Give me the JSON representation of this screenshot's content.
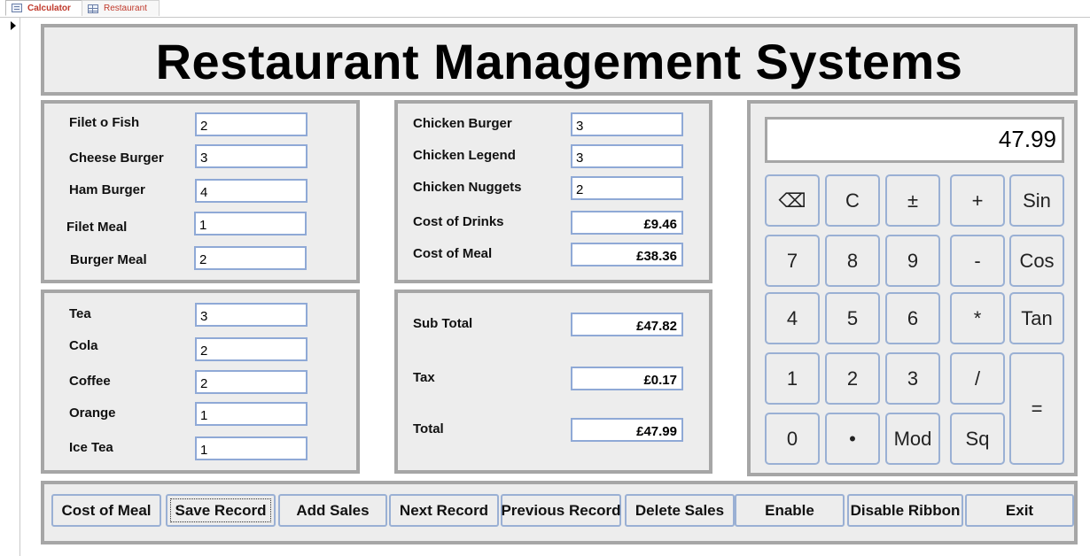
{
  "tabs": [
    {
      "label": "Calculator",
      "icon": "form-icon",
      "active": true
    },
    {
      "label": "Restaurant",
      "icon": "table-icon",
      "active": false
    }
  ],
  "title": "Restaurant Management Systems",
  "food": {
    "filet_o_fish": {
      "label": "Filet o Fish",
      "value": "2"
    },
    "cheese_burger": {
      "label": "Cheese Burger",
      "value": "3"
    },
    "ham_burger": {
      "label": "Ham Burger",
      "value": "4"
    },
    "filet_meal": {
      "label": "Filet Meal",
      "value": "1"
    },
    "burger_meal": {
      "label": "Burger Meal",
      "value": "2"
    }
  },
  "chicken": {
    "chicken_burger": {
      "label": "Chicken Burger",
      "value": "3"
    },
    "chicken_legend": {
      "label": "Chicken Legend",
      "value": "3"
    },
    "chicken_nuggets": {
      "label": "Chicken Nuggets",
      "value": "2"
    },
    "cost_of_drinks": {
      "label": "Cost of Drinks",
      "value": "£9.46"
    },
    "cost_of_meal": {
      "label": "Cost of Meal",
      "value": "£38.36"
    }
  },
  "drinks": {
    "tea": {
      "label": "Tea",
      "value": "3"
    },
    "cola": {
      "label": "Cola",
      "value": "2"
    },
    "coffee": {
      "label": "Coffee",
      "value": "2"
    },
    "orange": {
      "label": "Orange",
      "value": "1"
    },
    "ice_tea": {
      "label": "Ice Tea",
      "value": "1"
    }
  },
  "totals": {
    "sub_total": {
      "label": "Sub Total",
      "value": "£47.82"
    },
    "tax": {
      "label": "Tax",
      "value": "£0.17"
    },
    "total": {
      "label": "Total",
      "value": "£47.99"
    }
  },
  "calculator": {
    "display": "47.99",
    "keys": {
      "backspace": "⌫",
      "clear": "C",
      "plusminus": "±",
      "plus": "+",
      "sin": "Sin",
      "k7": "7",
      "k8": "8",
      "k9": "9",
      "minus": "-",
      "cos": "Cos",
      "k4": "4",
      "k5": "5",
      "k6": "6",
      "multiply": "*",
      "tan": "Tan",
      "k1": "1",
      "k2": "2",
      "k3": "3",
      "divide": "/",
      "equals": "=",
      "k0": "0",
      "dot": "•",
      "mod": "Mod",
      "sq": "Sq"
    }
  },
  "buttons": {
    "cost_of_meal": "Cost of Meal",
    "save_record": "Save Record",
    "add_sales": "Add Sales",
    "next_record": "Next Record",
    "previous_record": "Previous Record",
    "delete_sales": "Delete Sales",
    "enable": "Enable",
    "disable_ribbon": "Disable Ribbon",
    "exit": "Exit"
  }
}
